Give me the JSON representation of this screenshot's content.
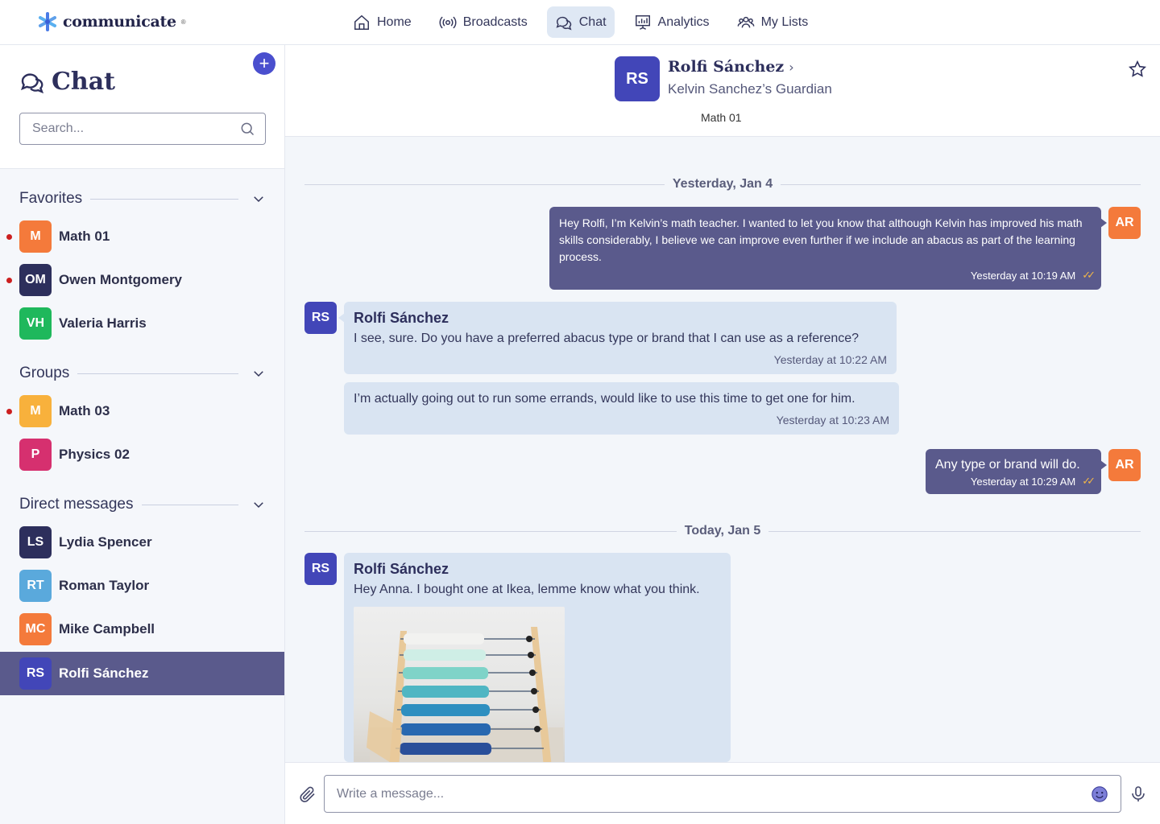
{
  "app": {
    "name": "communicate",
    "reg": "®"
  },
  "nav": [
    {
      "label": "Home",
      "icon": "home-icon"
    },
    {
      "label": "Broadcasts",
      "icon": "broadcast-icon"
    },
    {
      "label": "Chat",
      "icon": "chat-icon",
      "active": true
    },
    {
      "label": "Analytics",
      "icon": "analytics-icon"
    },
    {
      "label": "My Lists",
      "icon": "people-icon"
    }
  ],
  "sidebar": {
    "title": "Chat",
    "search_placeholder": "Search...",
    "favorites_label": "Favorites",
    "groups_label": "Groups",
    "dm_label": "Direct messages",
    "favorites": [
      {
        "initials": "M",
        "name": "Math 01",
        "color": "#f47a3b",
        "unread": true
      },
      {
        "initials": "OM",
        "name": "Owen Montgomery",
        "color": "#2d2f5c",
        "unread": true
      },
      {
        "initials": "VH",
        "name": "Valeria Harris",
        "color": "#1fb85c",
        "unread": false
      }
    ],
    "groups": [
      {
        "initials": "M",
        "name": "Math 03",
        "color": "#f8b13c",
        "unread": true
      },
      {
        "initials": "P",
        "name": "Physics 02",
        "color": "#d6306f",
        "unread": false
      }
    ],
    "direct_messages": [
      {
        "initials": "LS",
        "name": "Lydia Spencer",
        "color": "#2d2f5c"
      },
      {
        "initials": "RT",
        "name": "Roman Taylor",
        "color": "#5aa9dc"
      },
      {
        "initials": "MC",
        "name": "Mike Campbell",
        "color": "#f47a3b"
      },
      {
        "initials": "RS",
        "name": "Rolfi Sánchez",
        "color": "#4246b8",
        "active": true
      }
    ]
  },
  "conversation": {
    "avatar": "RS",
    "name": "Rolfi Sánchez",
    "chevron": "›",
    "subtitle": "Kelvin Sanchez’s Guardian",
    "class": "Math 01",
    "day1": "Yesterday, Jan 4",
    "day2": "Today, Jan 5",
    "me_initials": "AR",
    "them_initials": "RS",
    "messages": [
      {
        "text": "Hey Rolfi, I’m Kelvin’s math teacher. I wanted to let you know that although Kelvin has improved his math skills considerably, I believe we can improve even further if we include an abacus as part of the learning process.",
        "time": "Yesterday at 10:19 AM"
      },
      {
        "sender": "Rolfi Sánchez",
        "text": "I see, sure. Do you have a preferred abacus type or brand that I can use as a reference?",
        "time": "Yesterday at 10:22 AM"
      },
      {
        "text": "I’m actually going out to run some errands, would like to use this time to get one for him.",
        "time": "Yesterday at 10:23 AM"
      },
      {
        "text": "Any type or brand will do.",
        "time": "Yesterday at 10:29 AM"
      },
      {
        "sender": "Rolfi Sánchez",
        "text": "Hey Anna. I bought one at Ikea, lemme know what you think."
      }
    ]
  },
  "composer": {
    "placeholder": "Write a message..."
  }
}
